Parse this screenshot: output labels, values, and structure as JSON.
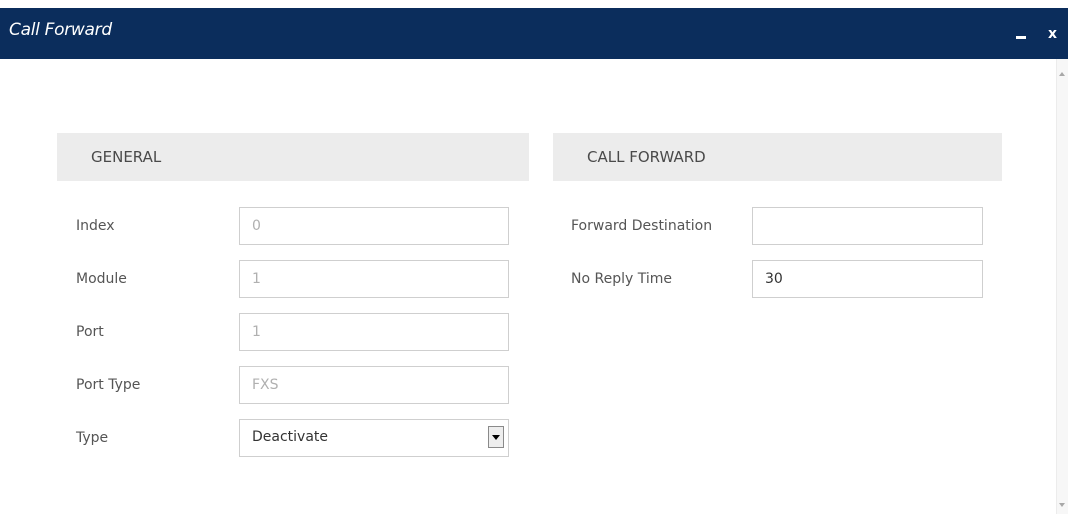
{
  "dialog": {
    "title": "Call Forward",
    "minimize_icon": "minimize-icon",
    "close_label": "x"
  },
  "general": {
    "header": "GENERAL",
    "fields": [
      {
        "label": "Index",
        "value": "0"
      },
      {
        "label": "Module",
        "value": "1"
      },
      {
        "label": "Port",
        "value": "1"
      },
      {
        "label": "Port Type",
        "value": "FXS"
      },
      {
        "label": "Type",
        "value": "Deactivate"
      }
    ]
  },
  "call_forward": {
    "header": "CALL FORWARD",
    "fields": [
      {
        "label": "Forward Destination",
        "value": ""
      },
      {
        "label": "No Reply Time",
        "value": "30"
      }
    ]
  },
  "colors": {
    "titlebar": "#0b2d5c",
    "section_header_bg": "#ececec"
  }
}
